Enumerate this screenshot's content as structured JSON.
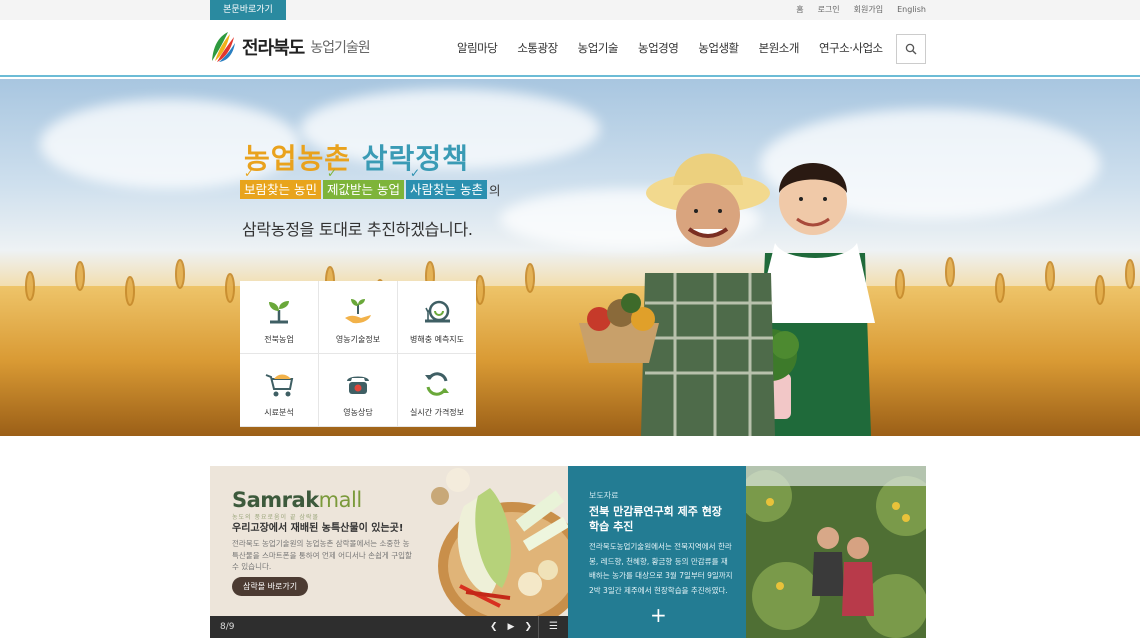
{
  "topbar": {
    "skip_link": "본문바로가기",
    "utility_links": [
      "홈",
      "로그인",
      "회원가입",
      "English"
    ]
  },
  "header": {
    "logo_main": "전라북도",
    "logo_sub": "농업기술원",
    "nav": [
      "알림마당",
      "소통광장",
      "농업기술",
      "농업경영",
      "농업생활",
      "본원소개",
      "연구소·사업소"
    ],
    "search_icon": "search-icon"
  },
  "hero": {
    "title_part1": "농업농촌",
    "title_part2": "삼락정책",
    "chip1": "보람찾는 농민",
    "chip2": "제값받는 농업",
    "chip3": "사람찾는 농촌",
    "chip_tail": "의",
    "line2": "삼락농정을 토대로 추진하겠습니다.",
    "quick_links": [
      {
        "label": "전북농업",
        "icon": "sprout-icon"
      },
      {
        "label": "영농기술정보",
        "icon": "hand-sprout-icon"
      },
      {
        "label": "병해충 예측지도",
        "icon": "snail-icon"
      },
      {
        "label": "시료분석",
        "icon": "wheelbarrow-icon"
      },
      {
        "label": "영농상담",
        "icon": "telephone-icon"
      },
      {
        "label": "실시간 가격정보",
        "icon": "refresh-icon"
      }
    ]
  },
  "mall": {
    "logo_a": "Samrak",
    "logo_b": "mall",
    "tagline": "농도의 풍요로움이 끝 삼락몰",
    "headline": "우리고장에서 재배된 농특산물이 있는곳!",
    "desc": "전라북도 농업기술원의 농업농촌 삼락몰에서는 소중한 농특산물을 스마트폰을 통하여 언제 어디서나 손쉽게 구입할수 있습니다.",
    "button": "삼락몰 바로가기",
    "pager_count": "8/9",
    "pager_prev": "❮",
    "pager_play": "▶",
    "pager_next": "❯",
    "pager_menu": "☰"
  },
  "news": {
    "category": "보도자료",
    "title": "전북 만감류연구회 제주 현장 학습 추진",
    "body": "전라북도농업기술원에서는 전북지역에서 한라봉, 레드향, 천혜향, 황금향 등의 만감류를 재배하는 농가를 대상으로 3월 7일부터 9일까지 2박 3일간 제주에서 현장학습을 추진하였다.",
    "plus": "+"
  },
  "colors": {
    "accent": "#2a8aa0",
    "yellow": "#e8a41c",
    "green": "#7eb43a",
    "blue": "#2b90b0",
    "news_bg": "#237c93"
  }
}
